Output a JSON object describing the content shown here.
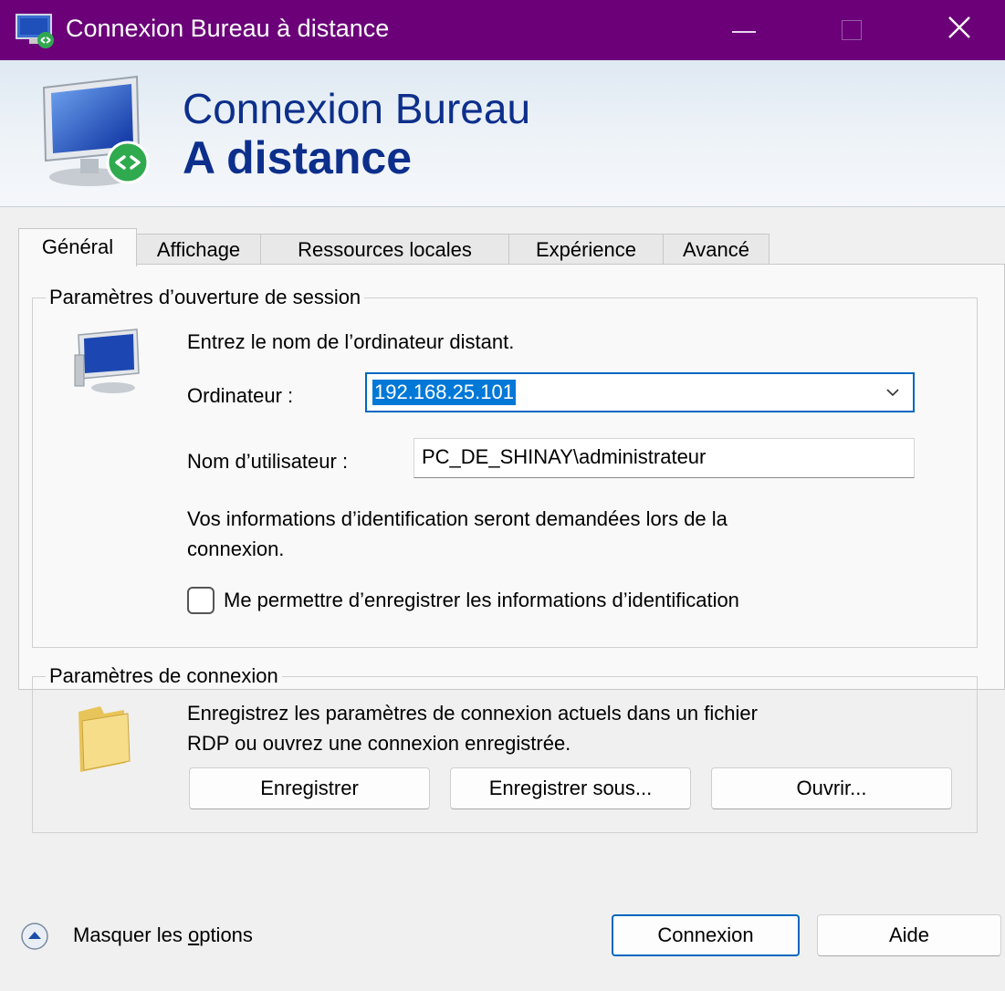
{
  "window": {
    "title": "Connexion Bureau à distance"
  },
  "banner": {
    "line1": "Connexion Bureau",
    "line2": "A distance"
  },
  "tabs": [
    "Général",
    "Affichage",
    "Ressources locales",
    "Expérience",
    "Avancé"
  ],
  "logon_group": {
    "legend": "Paramètres d’ouverture de session",
    "instruction": "Entrez le nom de l’ordinateur distant.",
    "computer_label": "Ordinateur :",
    "computer_value": "192.168.25.101",
    "username_label": "Nom d’utilisateur :",
    "username_value": "PC_DE_SHINAY\\administrateur",
    "info_line1": "Vos informations d’identification seront demandées lors de la",
    "info_line2": "connexion.",
    "remember_label": "Me permettre d’enregistrer les informations d’identification",
    "remember_checked": false
  },
  "connection_group": {
    "legend": "Paramètres de connexion",
    "desc_line1": "Enregistrez les paramètres de connexion actuels dans un fichier",
    "desc_line2": "RDP ou ouvrez une connexion enregistrée.",
    "save_label": "Enregistrer",
    "save_as_label": "Enregistrer sous...",
    "open_label": "Ouvrir..."
  },
  "footer": {
    "options_prefix": "Masquer les ",
    "options_access": "o",
    "options_suffix": "ptions",
    "connect_label": "Connexion",
    "help_label": "Aide"
  },
  "colors": {
    "titlebar": "#6b0079",
    "accent": "#0067c0",
    "banner_text": "#0d2f8c"
  }
}
